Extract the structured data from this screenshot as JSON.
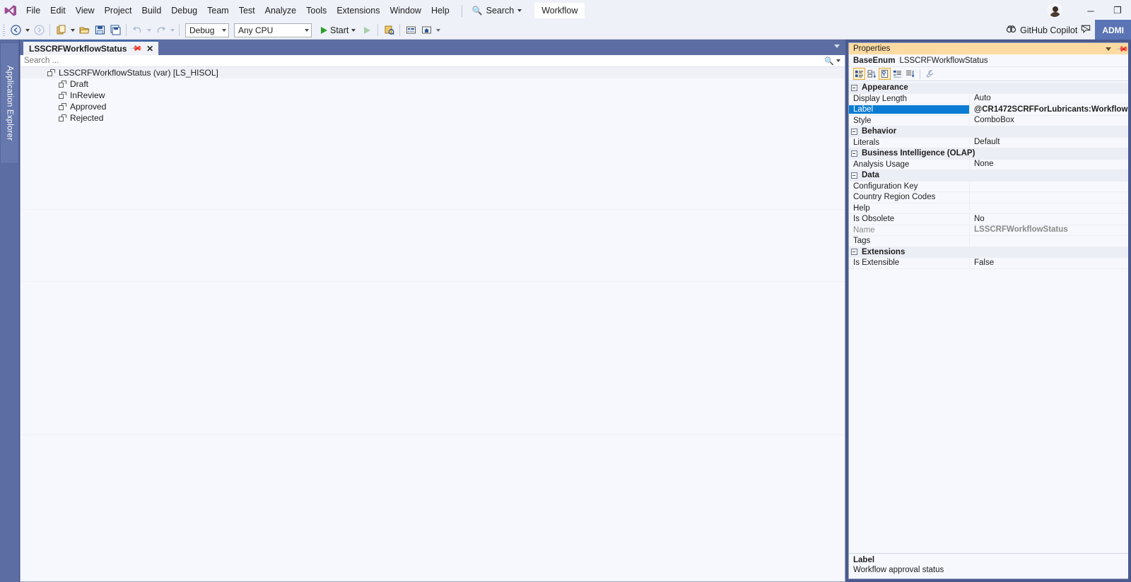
{
  "app": {
    "logo_icon": "visual-studio-logo",
    "menu": [
      {
        "label": "File"
      },
      {
        "label": "Edit"
      },
      {
        "label": "View"
      },
      {
        "label": "Project"
      },
      {
        "label": "Build"
      },
      {
        "label": "Debug"
      },
      {
        "label": "Team"
      },
      {
        "label": "Test"
      },
      {
        "label": "Analyze"
      },
      {
        "label": "Tools"
      },
      {
        "label": "Extensions"
      },
      {
        "label": "Window"
      },
      {
        "label": "Help"
      }
    ],
    "search": {
      "label": "Search",
      "icon": "magnifier-icon"
    },
    "workflow_tag": "Workflow",
    "copilot": {
      "label": "GitHub Copilot",
      "icon": "github-copilot-icon",
      "badge_icon": "copilot-chat-icon"
    },
    "admin_badge": "ADMI",
    "window_buttons": {
      "minimize": "─",
      "maximize": "❐"
    }
  },
  "toolbar": {
    "nav_back_icon": "back-arrow-icon",
    "nav_forward_icon": "forward-arrow-icon",
    "new_project_icon": "new-project-icon",
    "open_icon": "open-folder-icon",
    "save_icon": "save-icon",
    "save_all_icon": "save-all-icon",
    "undo_icon": "undo-icon",
    "redo_icon": "redo-icon",
    "config_value": "Debug",
    "platform_value": "Any CPU",
    "start_label": "Start",
    "start_icon": "play-icon",
    "attach_icon": "play-hollow-icon",
    "model_icon": "model-icon",
    "grid_icon": "grid-icon",
    "home_icon": "home-grid-icon",
    "overflow_icon": "overflow-icon"
  },
  "left_dock": {
    "tab_label": "Application Explorer"
  },
  "editor": {
    "tab": {
      "title": "LSSCRFWorkflowStatus",
      "pin_icon": "pin-icon",
      "close_icon": "close-icon"
    },
    "tabstrip_controls": {
      "dropdown_icon": "chevron-down-icon",
      "pin_icon": "pin-icon"
    },
    "search": {
      "placeholder": "Search ...",
      "icon": "magnifier-icon",
      "dropdown_icon": "chevron-down-icon"
    },
    "tree": {
      "root": {
        "label": "LSSCRFWorkflowStatus (var) [LS_HISOL]",
        "icon": "enum-icon"
      },
      "children": [
        {
          "label": "Draft",
          "icon": "enum-value-icon"
        },
        {
          "label": "InReview",
          "icon": "enum-value-icon"
        },
        {
          "label": "Approved",
          "icon": "enum-value-icon"
        },
        {
          "label": "Rejected",
          "icon": "enum-value-icon"
        }
      ]
    }
  },
  "properties": {
    "title": "Properties",
    "title_dropdown_icon": "chevron-down-icon",
    "title_pin_icon": "pin-icon",
    "subject_type": "BaseEnum",
    "subject_name": "LSSCRFWorkflowStatus",
    "toolbar": [
      {
        "icon": "categorized-icon",
        "active": true
      },
      {
        "icon": "alphabetical-sort-icon",
        "active": false
      },
      {
        "icon": "property-pages-icon",
        "active": true
      },
      {
        "icon": "events-icon",
        "active": false
      },
      {
        "icon": "messages-icon",
        "active": false
      },
      {
        "icon": "wrench-icon",
        "active": false
      }
    ],
    "rows": [
      {
        "kind": "category",
        "name": "Appearance",
        "expander": "−"
      },
      {
        "kind": "prop",
        "name": "Display Length",
        "value": "Auto"
      },
      {
        "kind": "prop",
        "name": "Label",
        "value": "@CR1472SCRFForLubricants:Workflow",
        "selected": true
      },
      {
        "kind": "prop",
        "name": "Style",
        "value": "ComboBox"
      },
      {
        "kind": "category",
        "name": "Behavior",
        "expander": "−"
      },
      {
        "kind": "prop",
        "name": "Literals",
        "value": "Default"
      },
      {
        "kind": "category",
        "name": "Business Intelligence (OLAP)",
        "expander": "−"
      },
      {
        "kind": "prop",
        "name": "Analysis Usage",
        "value": "None"
      },
      {
        "kind": "category",
        "name": "Data",
        "expander": "−"
      },
      {
        "kind": "prop",
        "name": "Configuration Key",
        "value": ""
      },
      {
        "kind": "prop",
        "name": "Country Region Codes",
        "value": ""
      },
      {
        "kind": "prop",
        "name": "Help",
        "value": ""
      },
      {
        "kind": "prop",
        "name": "Is Obsolete",
        "value": "No"
      },
      {
        "kind": "prop",
        "name": "Name",
        "value": "LSSCRFWorkflowStatus",
        "dim": true
      },
      {
        "kind": "prop",
        "name": "Tags",
        "value": ""
      },
      {
        "kind": "category",
        "name": "Extensions",
        "expander": "−"
      },
      {
        "kind": "prop",
        "name": "Is Extensible",
        "value": "False"
      }
    ],
    "description": {
      "title": "Label",
      "text": "Workflow approval status"
    }
  },
  "colors": {
    "menu_bg": "#eef1f8",
    "dock_bg": "#4a5a8e",
    "tab_accent": "#3d66a8",
    "props_title_bg": "#fcdba2",
    "selection_blue": "#0a7cd4",
    "admin_badge_bg": "#5b74b5",
    "editor_bg": "#f7f8fd"
  }
}
